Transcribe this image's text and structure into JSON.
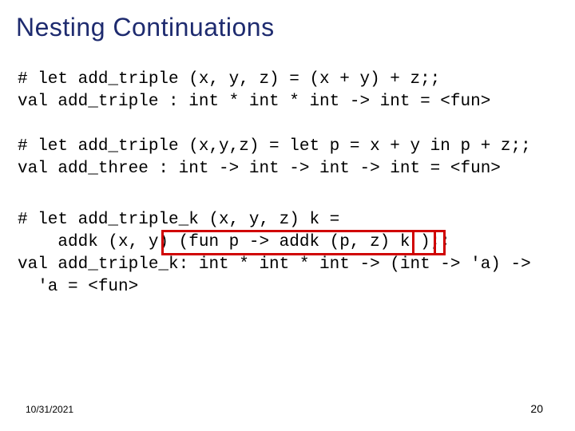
{
  "title": "Nesting Continuations",
  "code": {
    "block1": "# let add_triple (x, y, z) = (x + y) + z;;\nval add_triple : int * int * int -> int = <fun>",
    "block2": "# let add_triple (x,y,z) = let p = x + y in p + z;;\nval add_three : int -> int -> int -> int = <fun>",
    "block3": "# let add_triple_k (x, y, z) k =\n    addk (x, y) (fun p -> addk (p, z) k );;\nval add_triple_k: int * int * int -> (int -> 'a) ->\n  'a = <fun>"
  },
  "annotations": {
    "box_big_label": "continuation-argument-highlight",
    "box_small_label": "k-highlight"
  },
  "footer": {
    "date": "10/31/2021",
    "page": "20"
  }
}
